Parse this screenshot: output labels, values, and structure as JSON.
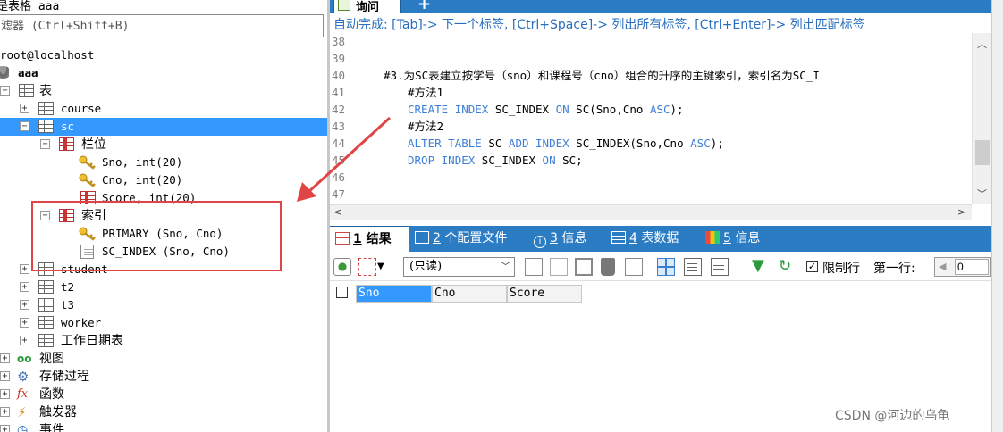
{
  "left_panel": {
    "title": "是表格 aaa",
    "filter_placeholder": "滤器 (Ctrl+Shift+B)",
    "tree": {
      "connection": "root@localhost",
      "database": "aaa",
      "tables_folder": "表",
      "tables": [
        "course",
        "sc",
        "student",
        "t2",
        "t3",
        "worker",
        "工作日期表"
      ],
      "columns_folder": "栏位",
      "columns": [
        "Sno, int(20)",
        "Cno, int(20)",
        "Score, int(20)"
      ],
      "indexes_folder": "索引",
      "indexes": [
        "PRIMARY (Sno, Cno)",
        "SC_INDEX (Sno, Cno)"
      ],
      "folders": [
        "视图",
        "存储过程",
        "函数",
        "触发器",
        "事件"
      ]
    }
  },
  "query_tab": {
    "label": "询问",
    "add_label": "+"
  },
  "autocomplete_hint": "自动完成: [Tab]-> 下一个标签, [Ctrl+Space]-> 列出所有标签, [Ctrl+Enter]-> 列出匹配标签",
  "editor": {
    "lines": [
      {
        "num": "38",
        "code": ""
      },
      {
        "num": "39",
        "code": ""
      },
      {
        "num": "40",
        "code": "#3.为SC表建立按学号（sno）和课程号（cno）组合的升序的主键索引，索引名为SC_I"
      },
      {
        "num": "41",
        "code": "#方法1"
      },
      {
        "num": "42",
        "code": "CREATE INDEX SC_INDEX ON SC(Sno,Cno ASC);"
      },
      {
        "num": "43",
        "code": "#方法2"
      },
      {
        "num": "44",
        "code": "ALTER TABLE SC ADD INDEX SC_INDEX(Sno,Cno ASC);"
      },
      {
        "num": "45",
        "code": "DROP INDEX SC_INDEX ON SC;"
      },
      {
        "num": "46",
        "code": ""
      },
      {
        "num": "47",
        "code": ""
      }
    ]
  },
  "result_tabs": [
    {
      "num": "1",
      "label": "结果"
    },
    {
      "num": "2",
      "label": "个配置文件"
    },
    {
      "num": "3",
      "label": "信息"
    },
    {
      "num": "4",
      "label": "表数据"
    },
    {
      "num": "5",
      "label": "信息"
    }
  ],
  "toolbar": {
    "readonly_value": "(只读)",
    "limit_label": "限制行",
    "first_row_label": "第一行:",
    "first_row_value": "0"
  },
  "grid": {
    "columns": [
      "Sno",
      "Cno",
      "Score"
    ]
  },
  "watermark": "CSDN @河边的乌龟",
  "colors": {
    "accent_blue": "#2c7cc4",
    "selection": "#3399ff",
    "keyword": "#3d7fd8",
    "comment": "#2e8b8b",
    "annotation_red": "#e04545"
  }
}
